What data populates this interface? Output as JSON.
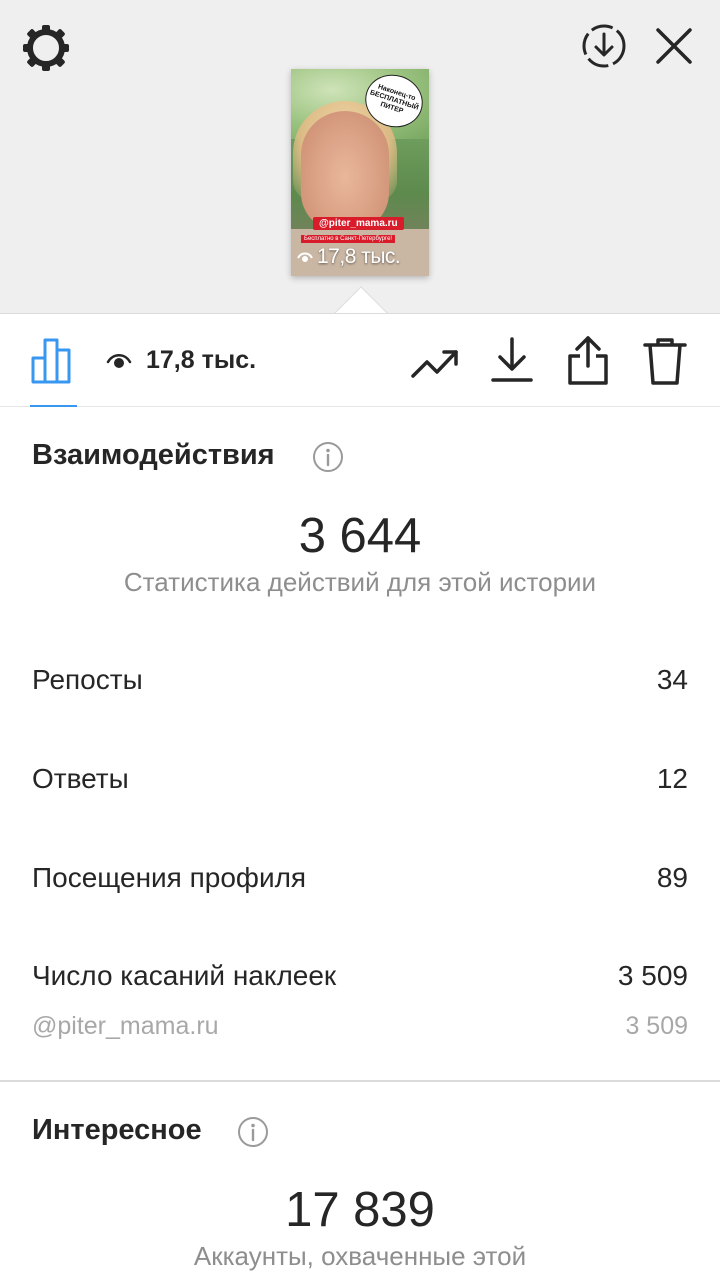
{
  "header": {
    "settings_icon": "settings-icon",
    "download_icon": "download-circle-icon",
    "close_icon": "close-icon"
  },
  "story_preview": {
    "sticker_text": "Наконец-то БЕСПЛАТНЫЙ ПИТЕР",
    "mention_tag": "@piter_mama.ru",
    "caption_line": "Бесплатно в Санкт-Петербурге!",
    "views": "17,8 тыс."
  },
  "toolbar": {
    "views": "17,8 тыс.",
    "active_tab_color": "#3897f0"
  },
  "interactions": {
    "title": "Взаимодействия",
    "total": "3 644",
    "caption": "Статистика действий для этой истории",
    "rows": [
      {
        "label": "Репосты",
        "value": "34"
      },
      {
        "label": "Ответы",
        "value": "12"
      },
      {
        "label": "Посещения профиля",
        "value": "89"
      },
      {
        "label": "Число касаний наклеек",
        "value": "3 509"
      }
    ],
    "sticker_detail": {
      "label": "@piter_mama.ru",
      "value": "3 509"
    }
  },
  "discovery": {
    "title": "Интересное",
    "total": "17 839",
    "caption": "Аккаунты, охваченные этой"
  }
}
